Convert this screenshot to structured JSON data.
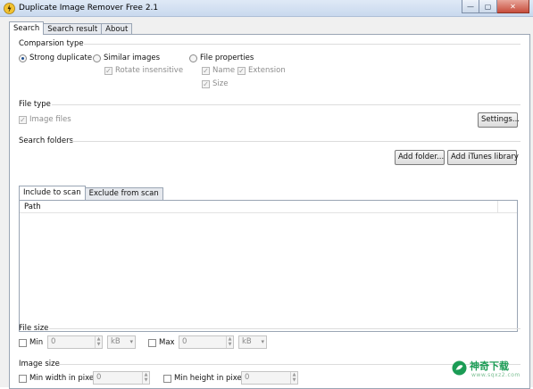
{
  "window": {
    "title": "Duplicate Image Remover Free 2.1",
    "buttons": {
      "minimize": "—",
      "maximize": "▢",
      "close": "✕"
    }
  },
  "tabs": [
    {
      "label": "Search",
      "active": true
    },
    {
      "label": "Search result",
      "active": false
    },
    {
      "label": "About",
      "active": false
    }
  ],
  "comparison": {
    "title": "Comparsion type",
    "strong": "Strong duplicate",
    "similar": "Similar images",
    "rotate": "Rotate insensitive",
    "file_props": "File properties",
    "name": "Name",
    "extension": "Extension",
    "size": "Size"
  },
  "file_type": {
    "title": "File type",
    "image_files": "Image files",
    "settings_button": "Settings..."
  },
  "search_folders": {
    "title": "Search folders",
    "add_folder": "Add folder...",
    "add_itunes": "Add iTunes library",
    "tab_include": "Include to scan",
    "tab_exclude": "Exclude from scan",
    "column_path": "Path"
  },
  "file_size": {
    "title": "File size",
    "min_label": "Min",
    "min_value": "0",
    "min_unit": "kB",
    "max_label": "Max",
    "max_value": "0",
    "max_unit": "kB"
  },
  "image_size": {
    "title": "Image size",
    "min_width_label": "Min width in pixel",
    "min_width_value": "0",
    "min_height_label": "Min height in pixel",
    "min_height_value": "0"
  },
  "watermark": {
    "text": "神奇下载",
    "sub": "www.sqxz2.com"
  },
  "colors": {
    "accent": "#1f4f8f",
    "watermark": "#1b9c55"
  },
  "icons": {
    "app": "app-icon",
    "spin": "spin-arrows-icon",
    "combo": "chevron-down-icon"
  }
}
